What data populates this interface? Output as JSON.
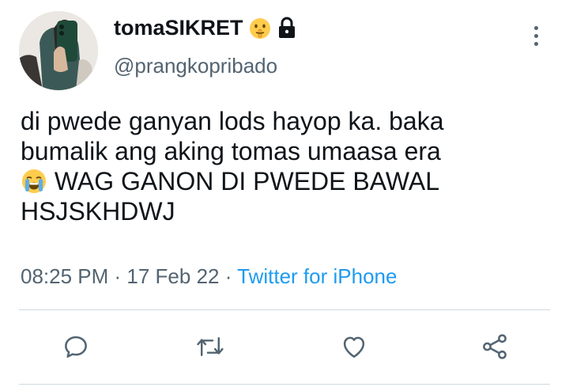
{
  "user": {
    "display_name": "tomaSIKRET",
    "name_emoji": "shushing-face-emoji",
    "lock_icon": "lock-icon",
    "handle": "@prangkopribado"
  },
  "tweet": {
    "line1": "di pwede ganyan lods hayop ka. baka",
    "line2": "bumalik ang aking tomas umaasa era",
    "line3_emoji": "loudly-crying-face-emoji",
    "line3": " WAG GANON DI PWEDE BAWAL",
    "line4": "HSJSKHDWJ"
  },
  "meta": {
    "time": "08:25 PM",
    "separator1": " · ",
    "date": "17 Feb 22",
    "separator2": " · ",
    "source": "Twitter for iPhone"
  },
  "actions": [
    "reply-icon",
    "retweet-icon",
    "like-icon",
    "share-icon"
  ],
  "colors": {
    "text": "#0f1419",
    "secondary": "#536471",
    "link": "#1d9bf0",
    "divider": "#cfd9de"
  }
}
